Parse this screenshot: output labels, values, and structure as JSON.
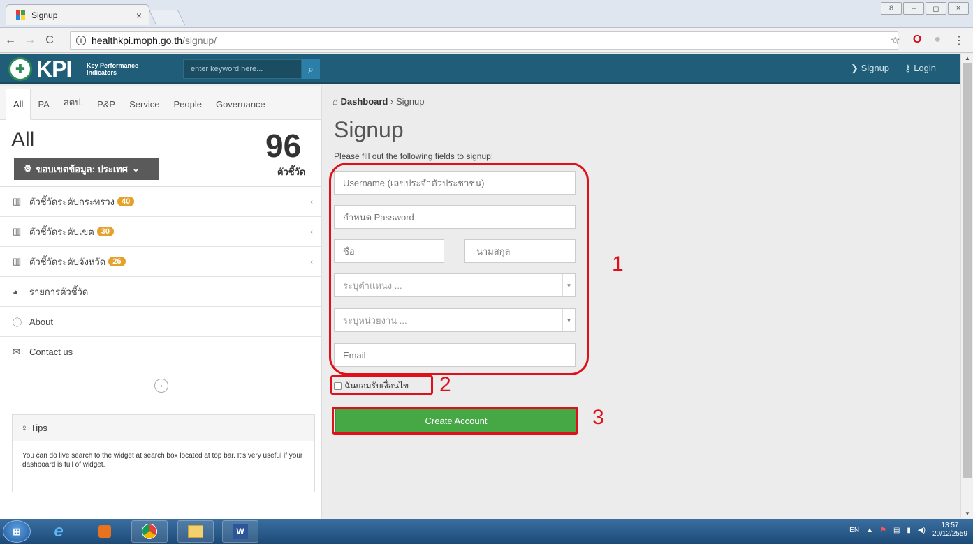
{
  "browser": {
    "tab_title": "Signup",
    "tab_close": "×",
    "url_host": "healthkpi.moph.go.th",
    "url_path": "/signup/",
    "window_controls": [
      "8",
      "–",
      "◻",
      "×"
    ]
  },
  "header": {
    "logo_text": "KPI",
    "logo_sub_line1": "Key Performance",
    "logo_sub_line2": "Indicators",
    "search_placeholder": "enter keyword here...",
    "signup_link": "Signup",
    "login_link": "Login"
  },
  "left": {
    "tabs": [
      "All",
      "PA",
      "สตป.",
      "P&P",
      "Service",
      "People",
      "Governance"
    ],
    "title": "All",
    "count": "96",
    "count_unit": "ตัวชี้วัด",
    "scope_button": "ขอบเขตข้อมูล: ประเทศ",
    "menu": [
      {
        "label": "ตัวชี้วัดระดับกระทรวง",
        "badge": "40",
        "icon": "bar-chart-icon"
      },
      {
        "label": "ตัวชี้วัดระดับเขต",
        "badge": "30",
        "icon": "bar-chart-icon"
      },
      {
        "label": "ตัวชี้วัดระดับจังหวัด",
        "badge": "26",
        "icon": "bar-chart-icon"
      },
      {
        "label": "รายการตัวชี้วัด",
        "icon": "dashboard-icon"
      },
      {
        "label": "About",
        "icon": "info-icon"
      },
      {
        "label": "Contact us",
        "icon": "envelope-icon"
      }
    ],
    "tips_title": "Tips",
    "tips_body": "You can do live search to the widget at search box located at top bar. It's very useful if your dashboard is full of widget."
  },
  "main": {
    "breadcrumb_home": "Dashboard",
    "breadcrumb_current": "Signup",
    "title": "Signup",
    "instructions": "Please fill out the following fields to signup:",
    "username_placeholder": "Username (เลขประจำตัวประชาชน)",
    "password_placeholder": "กำหนด Password",
    "firstname_placeholder": "ชื่อ",
    "lastname_placeholder": "นามสกุล",
    "position_placeholder": "ระบุตำแหน่ง ...",
    "unit_placeholder": "ระบุหน่วยงาน ...",
    "email_placeholder": "Email",
    "agree_label": "ฉันยอมรับเงื่อนไข",
    "create_button": "Create Account",
    "annotations": [
      "1",
      "2",
      "3"
    ]
  },
  "taskbar": {
    "lang": "EN",
    "time": "13:57",
    "date": "20/12/2559"
  },
  "colors": {
    "header_bg": "#1f5d78",
    "create_button": "#46a845",
    "badge": "#e4a12b",
    "annotation": "#e0101a"
  }
}
